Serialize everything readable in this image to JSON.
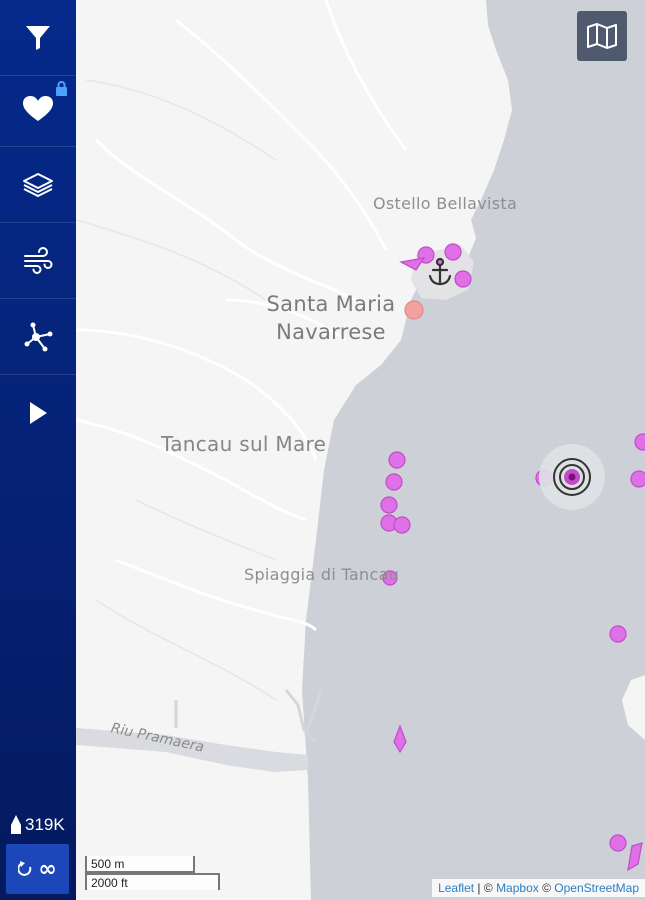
{
  "sidebar": {
    "buttons": [
      {
        "name": "filter-button",
        "icon": "filter-icon"
      },
      {
        "name": "favorites-button",
        "icon": "heart-icon",
        "locked": true
      },
      {
        "name": "layers-button",
        "icon": "layers-icon"
      },
      {
        "name": "weather-button",
        "icon": "wind-icon"
      },
      {
        "name": "network-button",
        "icon": "network-icon"
      },
      {
        "name": "play-button",
        "icon": "play-icon"
      }
    ],
    "ship_count": "319K",
    "playback": {
      "icon": "replay-icon",
      "value": "∞"
    }
  },
  "map": {
    "places": {
      "ostello": "Ostello Bellavista",
      "santa_maria_line1": "Santa Maria",
      "santa_maria_line2": "Navarrese",
      "tancau_sul_mare": "Tancau sul Mare",
      "spiaggia": "Spiaggia di Tancau",
      "river": "Riu Pramaera"
    },
    "scale": {
      "metric": "500 m",
      "imperial": "2000 ft"
    },
    "attribution": {
      "leaflet": "Leaflet",
      "sep1": " | © ",
      "mapbox": "Mapbox",
      "sep2": " © ",
      "osm": "OpenStreetMap"
    },
    "colors": {
      "sea": "#cdd0d7",
      "land": "#f5f5f5",
      "vessel": "#e070e8",
      "vessel_stroke": "#c04cc8",
      "selected": "#9a1aa0",
      "sidebar": "#052a8c"
    }
  }
}
